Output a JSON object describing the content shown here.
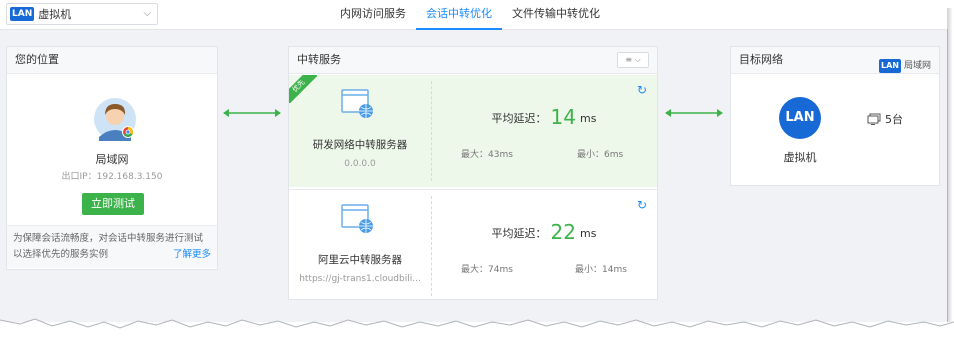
{
  "topbar": {
    "selector": {
      "badge": "LAN",
      "value": "虚拟机"
    },
    "tabs": [
      {
        "label": "内网访问服务",
        "active": false
      },
      {
        "label": "会话中转优化",
        "active": true
      },
      {
        "label": "文件传输中转优化",
        "active": false
      }
    ]
  },
  "location": {
    "title": "您的位置",
    "name": "局域网",
    "ip": "出口IP：192.168.3.150",
    "test_button": "立即测试",
    "tip": "为保障会话流畅度，对会话中转服务进行测试以选择优先的服务实例",
    "learn_more": "了解更多"
  },
  "relay": {
    "title": "中转服务",
    "sort_icon": "sort-icon",
    "servers": [
      {
        "badge": "优先",
        "name": "研发网络中转服务器",
        "address": "0.0.0.0",
        "latency_label": "平均延迟：",
        "latency_value": "14",
        "latency_unit": "ms",
        "max": "最大：43ms",
        "min": "最小：6ms"
      },
      {
        "name": "阿里云中转服务器",
        "address": "https://gj-trans1.cloudbili...",
        "latency_label": "平均延迟：",
        "latency_value": "22",
        "latency_unit": "ms",
        "max": "最大：74ms",
        "min": "最小：14ms"
      }
    ]
  },
  "target": {
    "title": "目标网络",
    "network_badge": "LAN",
    "network_label": "局域网",
    "circle_label": "LAN",
    "name": "虚拟机",
    "devices": "5台"
  },
  "colors": {
    "accent": "#1a8cff",
    "green": "#3cb34a",
    "lan_blue": "#1769d6"
  }
}
